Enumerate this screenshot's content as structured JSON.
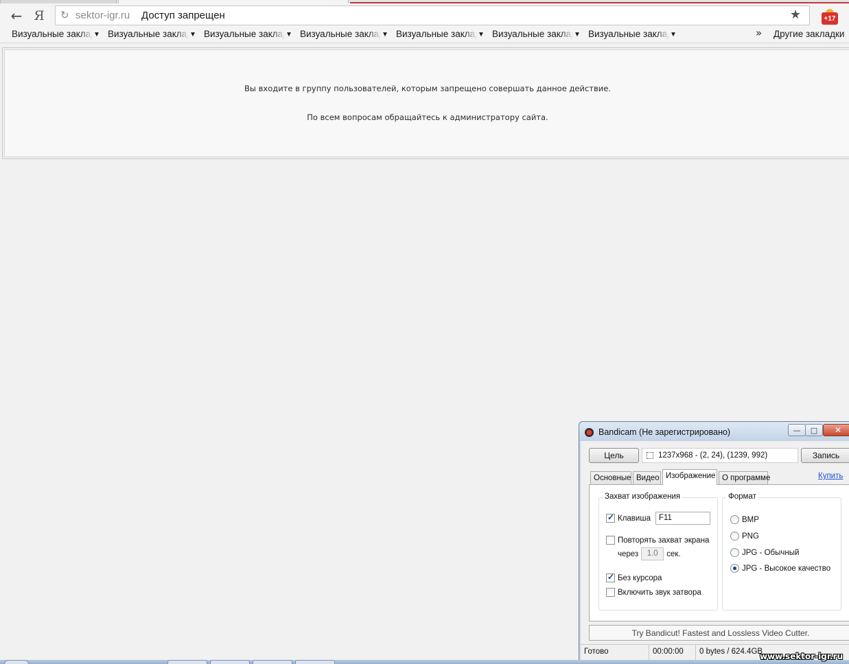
{
  "browser": {
    "address": {
      "domain": "sektor-igr.ru",
      "page_title": "Доступ запрещен"
    },
    "icons": {
      "back": "back-arrow-icon",
      "yandex": "yandex-logo-icon",
      "refresh": "refresh-icon",
      "bookmark_star": "star-icon",
      "extension": "gift-extension-icon"
    },
    "extension_badge": "+17",
    "bookmarks": [
      {
        "label": "Визуальные закладки"
      },
      {
        "label": "Визуальные закладки"
      },
      {
        "label": "Визуальные закладки"
      },
      {
        "label": "Визуальные закладки"
      },
      {
        "label": "Визуальные закладки"
      },
      {
        "label": "Визуальные закладки"
      },
      {
        "label": "Визуальные закладки"
      }
    ],
    "bookmarks_more": "»",
    "other_bookmarks": "Другие закладки"
  },
  "page": {
    "message_line1": "Вы входите в группу пользователей, которым запрещено совершать данное действие.",
    "message_line2": "По всем вопросам обращайтесь к администратору сайта."
  },
  "bandicam": {
    "title": "Bandicam (Не зарегистрировано)",
    "target_button": "Цель",
    "target_value": "1237x968 - (2, 24), (1239, 992)",
    "record_button": "Запись",
    "tabs": [
      {
        "label": "Основные",
        "active": false
      },
      {
        "label": "Видео",
        "active": false
      },
      {
        "label": "Изображение",
        "active": true
      },
      {
        "label": "О программе",
        "active": false
      }
    ],
    "buy_link": "Купить",
    "capture_group": {
      "legend": "Захват изображения",
      "hotkey_label": "Клавиша",
      "hotkey_checked": true,
      "hotkey_value": "F11",
      "repeat_label": "Повторять захват экрана",
      "repeat_checked": false,
      "every_label": "через",
      "every_value": "1.0",
      "seconds_label": "сек.",
      "no_cursor_label": "Без курсора",
      "no_cursor_checked": true,
      "shutter_label": "Включить звук затвора",
      "shutter_checked": false
    },
    "format_group": {
      "legend": "Формат",
      "options": [
        {
          "label": "BMP",
          "selected": false
        },
        {
          "label": "PNG",
          "selected": false
        },
        {
          "label": "JPG - Обычный",
          "selected": false
        },
        {
          "label": "JPG - Высокое качество",
          "selected": true
        }
      ]
    },
    "promo": "Try Bandicut! Fastest and Lossless Video Cutter.",
    "status": {
      "state": "Готово",
      "time": "00:00:00",
      "size": "0 bytes / 624.4GB"
    }
  },
  "watermark": "www.sektor-igr.ru",
  "colors": {
    "accent_red": "#c2383b",
    "link_blue": "#1f4fd1",
    "check_blue": "#1e3f8a"
  }
}
